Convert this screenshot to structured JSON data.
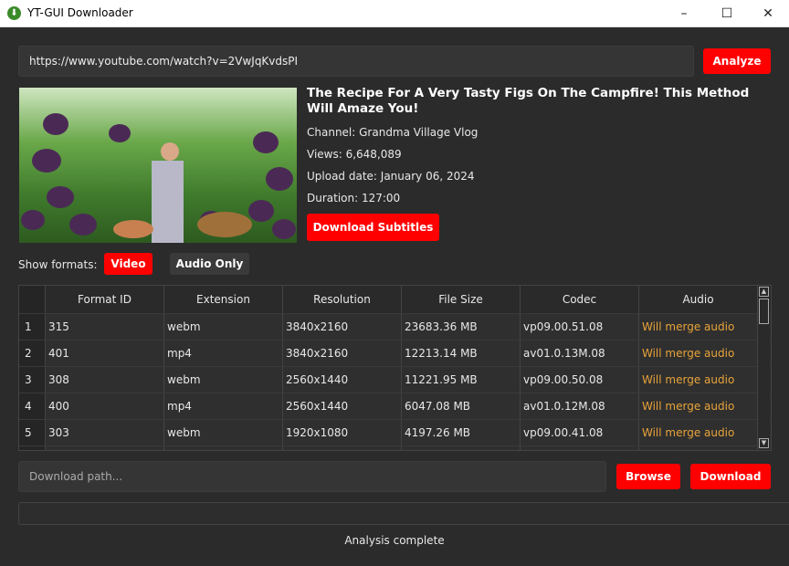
{
  "window": {
    "title": "YT-GUI Downloader",
    "minimize": "–",
    "maximize": "☐",
    "close": "✕"
  },
  "url_input": {
    "value": "https://www.youtube.com/watch?v=2VwJqKvdsPI"
  },
  "analyze_label": "Analyze",
  "video": {
    "title": "The Recipe For A Very Tasty Figs On The Campfire! This Method Will Amaze You!",
    "channel": "Channel: Grandma Village Vlog",
    "views": "Views: 6,648,089",
    "upload_date": "Upload date: January 06, 2024",
    "duration": "Duration: 127:00"
  },
  "download_subtitles_label": "Download Subtitles",
  "formats": {
    "label": "Show formats:",
    "video": "Video",
    "audio_only": "Audio Only"
  },
  "table": {
    "headers": [
      "Format ID",
      "Extension",
      "Resolution",
      "File Size",
      "Codec",
      "Audio"
    ],
    "rows": [
      {
        "n": "1",
        "id": "315",
        "ext": "webm",
        "res": "3840x2160",
        "size": "23683.36 MB",
        "codec": "vp09.00.51.08",
        "audio": "Will merge audio"
      },
      {
        "n": "2",
        "id": "401",
        "ext": "mp4",
        "res": "3840x2160",
        "size": "12213.14 MB",
        "codec": "av01.0.13M.08",
        "audio": "Will merge audio"
      },
      {
        "n": "3",
        "id": "308",
        "ext": "webm",
        "res": "2560x1440",
        "size": "11221.95 MB",
        "codec": "vp09.00.50.08",
        "audio": "Will merge audio"
      },
      {
        "n": "4",
        "id": "400",
        "ext": "mp4",
        "res": "2560x1440",
        "size": "6047.08 MB",
        "codec": "av01.0.12M.08",
        "audio": "Will merge audio"
      },
      {
        "n": "5",
        "id": "303",
        "ext": "webm",
        "res": "1920x1080",
        "size": "4197.26 MB",
        "codec": "vp09.00.41.08",
        "audio": "Will merge audio"
      }
    ]
  },
  "path_input": {
    "placeholder": "Download path..."
  },
  "browse_label": "Browse",
  "download_label": "Download",
  "status": "Analysis complete",
  "colors": {
    "accent": "#ff0000",
    "audio_text": "#e8a33a",
    "background": "#2b2b2b"
  }
}
